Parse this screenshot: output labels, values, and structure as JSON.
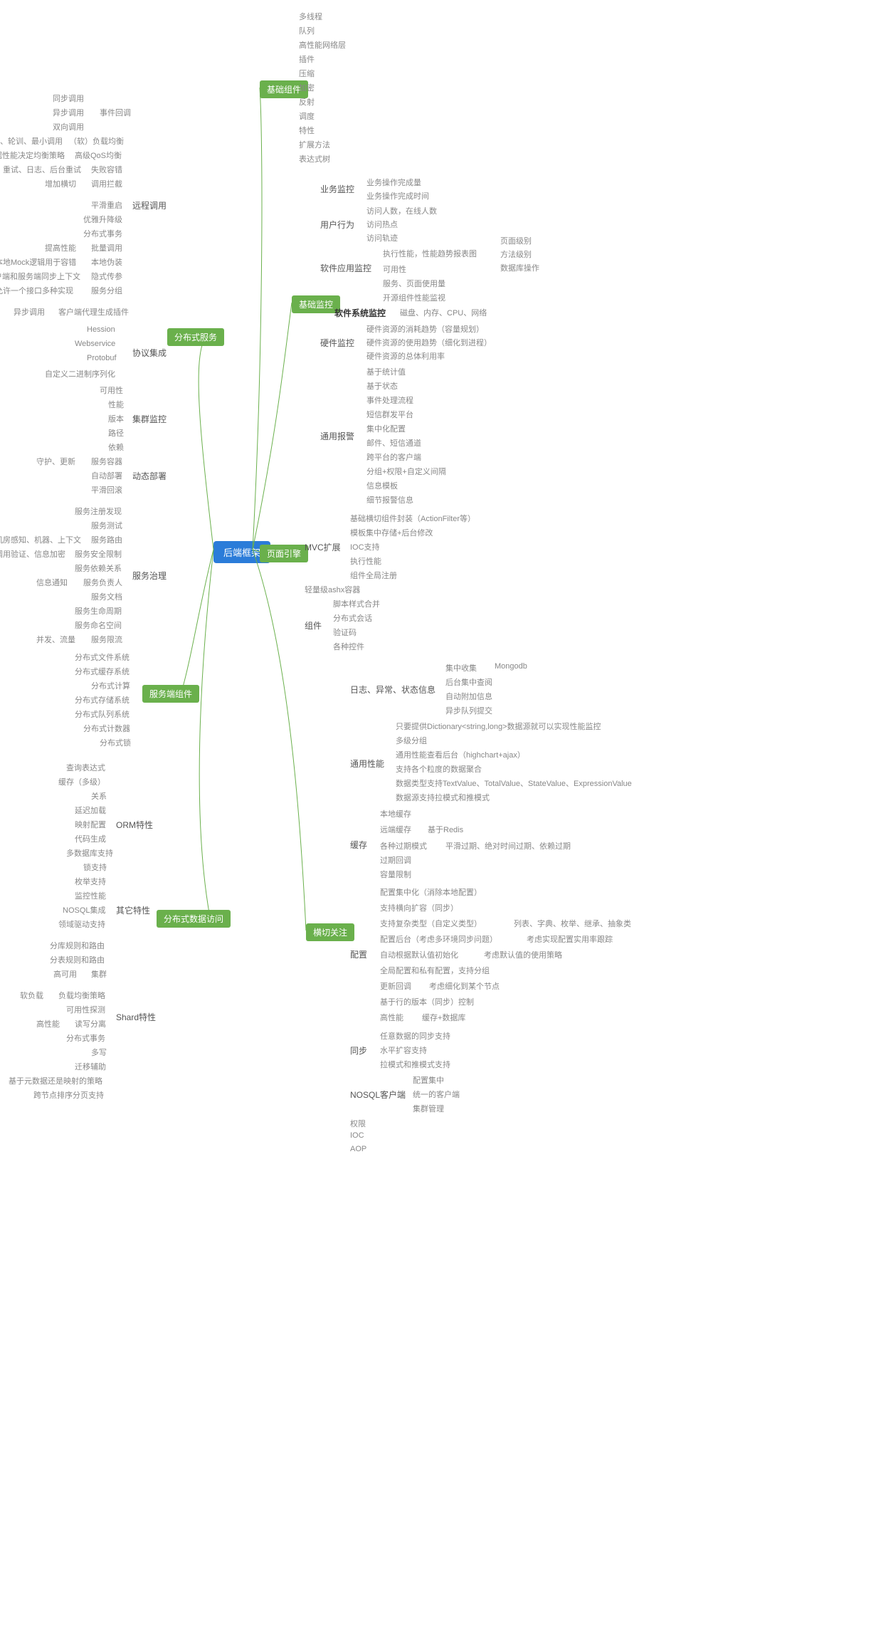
{
  "root": "后端框架",
  "branches": {
    "basicComp": "基础组件",
    "basicMon": "基础监控",
    "pageEngine": "页面引擎",
    "crossCut": "横切关注",
    "distSvc": "分布式服务",
    "svcComp": "服务端组件",
    "distData": "分布式数据访问"
  },
  "basicComp": [
    "多线程",
    "队列",
    "高性能网络层",
    "插件",
    "压缩",
    "加密",
    "反射",
    "调度",
    "特性",
    "扩展方法",
    "表达式树"
  ],
  "basicMon": {
    "biz": {
      "label": "业务监控",
      "items": [
        "业务操作完成量",
        "业务操作完成时间"
      ]
    },
    "userBeh": {
      "label": "用户行为",
      "items": [
        "访问人数，在线人数",
        "访问热点",
        "访问轨迹"
      ]
    },
    "appMon": {
      "label": "软件应用监控",
      "perf": {
        "label": "执行性能，性能趋势报表图",
        "items": [
          "页面级别",
          "方法级别",
          "数据库操作"
        ]
      },
      "items": [
        "可用性",
        "服务、页面使用量",
        "开源组件性能监视"
      ]
    },
    "sysMon": {
      "label": "软件系统监控",
      "items": [
        "磁盘、内存、CPU、网络"
      ]
    },
    "hwMon": {
      "label": "硬件监控",
      "items": [
        "硬件资源的消耗趋势（容量规划）",
        "硬件资源的使用趋势（细化到进程）",
        "硬件资源的总体利用率"
      ]
    },
    "alarm": {
      "label": "通用报警",
      "items": [
        "基于统计值",
        "基于状态",
        "事件处理流程",
        "短信群发平台",
        "集中化配置",
        "邮件、短信通道",
        "跨平台的客户端",
        "分组+权限+自定义间隔",
        "信息模板",
        "细节报警信息"
      ]
    }
  },
  "pageEngine": {
    "mvc": {
      "label": "MVC扩展",
      "items": [
        "基础横切组件封装（ActionFilter等）",
        "模板集中存储+后台修改",
        "IOC支持",
        "执行性能",
        "组件全局注册"
      ]
    },
    "ashx": "轻量级ashx容器",
    "comp": {
      "label": "组件",
      "items": [
        "脚本样式合并",
        "分布式会话",
        "验证码",
        "各种控件"
      ]
    }
  },
  "crossCut": {
    "log": {
      "label": "日志、异常、状态信息",
      "items": [
        "集中收集",
        "后台集中查阅",
        "自动附加信息",
        "异步队列提交"
      ],
      "mongo": "Mongodb"
    },
    "perf": {
      "label": "通用性能",
      "items": [
        "只要提供Dictionary<string,long>数据源就可以实现性能监控",
        "多级分组",
        "通用性能查看后台（highchart+ajax）",
        "支持各个粒度的数据聚合",
        "数据类型支持TextValue、TotalValue、StateValue、ExpressionValue",
        "数据源支持拉模式和推模式"
      ]
    },
    "cache": {
      "label": "缓存",
      "local": "本地缓存",
      "remote": "远端缓存",
      "remoteNote": "基于Redis",
      "expire": "各种过期模式",
      "expireNote": "平滑过期、绝对时间过期、依赖过期",
      "cb": "过期回调",
      "cap": "容量限制"
    },
    "config": {
      "label": "配置",
      "items": [
        "配置集中化（消除本地配置）",
        "支持横向扩容（同步）"
      ],
      "complex": "支持复杂类型（自定义类型）",
      "complexNote": "列表、字典、枚举、继承、抽象类",
      "backend": "配置后台（考虑多环境同步问题）",
      "backendNote": "考虑实现配置实用率跟踪",
      "auto": "自动根据默认值初始化",
      "autoNote": "考虑默认值的使用策略",
      "group": "全局配置和私有配置，支持分组",
      "update": "更新回调",
      "updateNote": "考虑细化到某个节点",
      "version": "基于行的版本（同步）控制",
      "hp": "高性能",
      "hpNote": "缓存+数据库"
    },
    "sync": {
      "label": "同步",
      "items": [
        "任意数据的同步支持",
        "水平扩容支持",
        "拉模式和推模式支持"
      ]
    },
    "nosql": {
      "label": "NOSQL客户端",
      "items": [
        "配置集中",
        "统一的客户端",
        "集群管理"
      ]
    },
    "others": [
      "权限",
      "IOC",
      "AOP"
    ]
  },
  "distSvc": {
    "remote": {
      "label": "远程调用",
      "items": [
        "平滑重启",
        "优雅升降级",
        "分布式事务"
      ],
      "batch": {
        "label": "批量调用",
        "note": "提高性能"
      },
      "mock": {
        "label": "本地伪装",
        "note": "本地Mock逻辑用于容错"
      },
      "implicit": {
        "label": "隐式传参",
        "note": "客户端和服务端同步上下文"
      },
      "group": {
        "label": "服务分组",
        "note": "允许一个接口多种实现"
      },
      "proxy": {
        "label": "客户端代理生成插件",
        "note": "异步调用"
      },
      "cb": {
        "label": "事件回调",
        "items": [
          "同步调用",
          "异步调用",
          "双向调用"
        ]
      },
      "lb": {
        "label": "（软）负载均衡",
        "note": "随机、轮训、最小调用"
      },
      "qos": {
        "label": "高级QoS均衡",
        "note": "根据性能决定均衡策略"
      },
      "fail": {
        "label": "失败容错",
        "note": "重试、日志、后台重试"
      },
      "intercept": {
        "label": "调用拦截",
        "note": "增加横切"
      }
    },
    "proto": {
      "label": "协议集成",
      "items": [
        "Hession",
        "Webservice",
        "Protobuf",
        "自定义二进制序列化"
      ]
    },
    "cluster": {
      "label": "集群监控",
      "items": [
        "可用性",
        "性能",
        "版本",
        "路径",
        "依赖"
      ]
    },
    "deploy": {
      "label": "动态部署",
      "items": [
        "自动部署",
        "平滑回滚"
      ],
      "container": {
        "label": "服务容器",
        "note": "守护、更新"
      }
    },
    "gov": {
      "label": "服务治理",
      "items": [
        "服务注册发现",
        "服务测试",
        "服务依赖关系",
        "服务文档",
        "服务生命周期",
        "服务命名空间"
      ],
      "route": {
        "label": "服务路由",
        "note": "机房感知、机器、上下文"
      },
      "sec": {
        "label": "服务安全限制",
        "note": "调用验证、信息加密"
      },
      "owner": {
        "label": "服务负责人",
        "note": "信息通知"
      },
      "limit": {
        "label": "服务限流",
        "note": "并发、流量"
      }
    }
  },
  "svcComp": [
    "分布式文件系统",
    "分布式缓存系统",
    "分布式计算",
    "分布式存储系统",
    "分布式队列系统",
    "分布式计数器",
    "分布式锁"
  ],
  "distData": {
    "orm": {
      "label": "ORM特性",
      "items": [
        "查询表达式",
        "缓存（多级）",
        "关系",
        "延迟加载",
        "映射配置",
        "代码生成",
        "多数据库支持",
        "锁支持",
        "枚举支持"
      ]
    },
    "other": {
      "label": "其它特性",
      "items": [
        "监控性能",
        "NOSQL集成",
        "领域驱动支持"
      ]
    },
    "shard": {
      "label": "Shard特性",
      "items": [
        "分库规则和路由",
        "分表规则和路由",
        "分布式事务",
        "多写",
        "迁移辅助",
        "基于元数据还是映射的策略",
        "跨节点排序分页支持"
      ],
      "cluster": {
        "label": "集群",
        "note": "高可用"
      },
      "lb": {
        "label": "负载均衡策略",
        "note": "软负载"
      },
      "probe": "可用性探测",
      "rw": {
        "label": "读写分离",
        "note": "高性能"
      }
    }
  }
}
